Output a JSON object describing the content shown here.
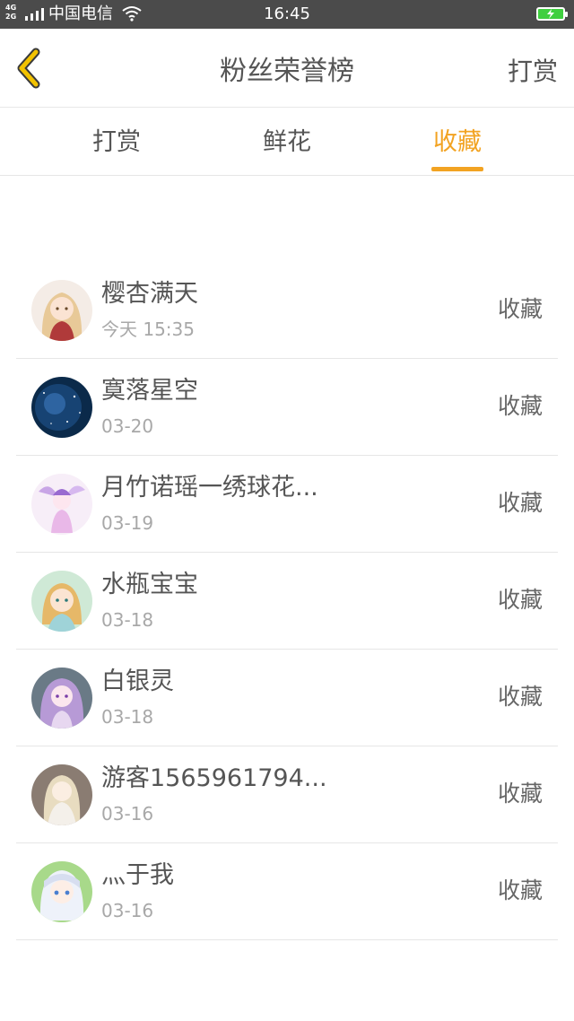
{
  "status_bar": {
    "network_top": "4G",
    "network_bottom": "2G",
    "carrier": "中国电信",
    "time": "16:45",
    "icons": [
      "signal-icon",
      "wifi-icon",
      "battery-charging-icon"
    ],
    "battery_color": "#3fcf3f"
  },
  "header": {
    "title": "粉丝荣誉榜",
    "right_action": "打赏",
    "back_icon": "chevron-left-icon",
    "back_icon_color": "#f2c200"
  },
  "tabs": {
    "items": [
      "打赏",
      "鲜花",
      "收藏"
    ],
    "active_index": 2,
    "active_color": "#f2a322"
  },
  "list": {
    "items": [
      {
        "name": "樱杏满天",
        "time": "今天 15:35",
        "action": "收藏",
        "avatar": "avatar-anime-girl-blonde"
      },
      {
        "name": "寞落星空",
        "time": "03-20",
        "action": "收藏",
        "avatar": "avatar-starry-space"
      },
      {
        "name": "月竹诺瑶一绣球花...",
        "time": "03-19",
        "action": "收藏",
        "avatar": "avatar-fairy-purple"
      },
      {
        "name": "水瓶宝宝",
        "time": "03-18",
        "action": "收藏",
        "avatar": "avatar-anime-girl-green"
      },
      {
        "name": "白银灵",
        "time": "03-18",
        "action": "收藏",
        "avatar": "avatar-anime-girl-purple-hair"
      },
      {
        "name": "游客1565961794...",
        "time": "03-16",
        "action": "收藏",
        "avatar": "avatar-anime-girl-white-dress"
      },
      {
        "name": "灬于我",
        "time": "03-16",
        "action": "收藏",
        "avatar": "avatar-anime-girl-silver-hair"
      }
    ]
  }
}
